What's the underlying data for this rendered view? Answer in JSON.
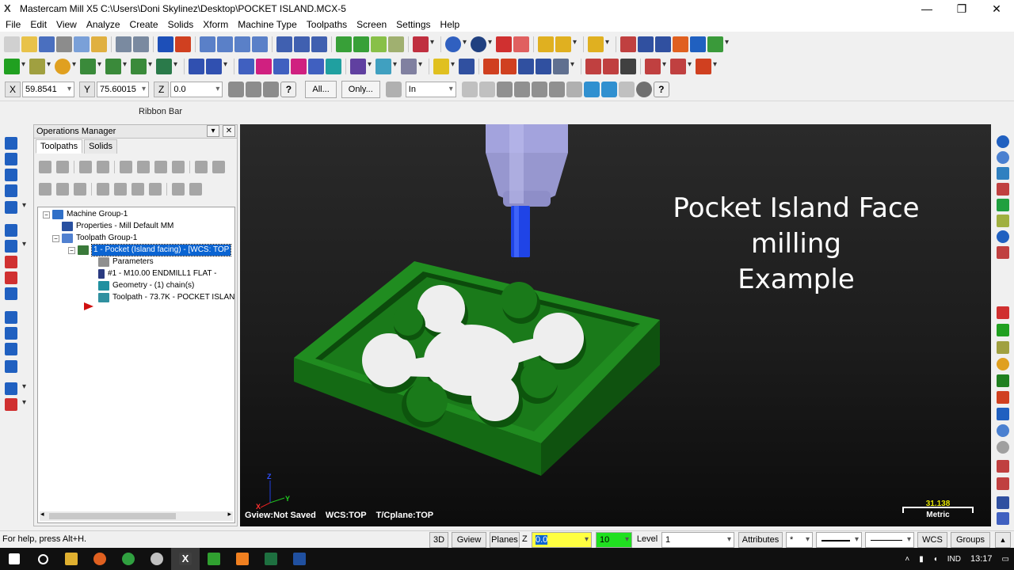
{
  "titlebar": {
    "title": "Mastercam Mill X5  C:\\Users\\Doni Skylinez\\Desktop\\POCKET ISLAND.MCX-5",
    "minimize": "—",
    "maximize": "❐",
    "close": "✕"
  },
  "menu": [
    "File",
    "Edit",
    "View",
    "Analyze",
    "Create",
    "Solids",
    "Xform",
    "Machine Type",
    "Toolpaths",
    "Screen",
    "Settings",
    "Help"
  ],
  "ribbon": {
    "x_label": "X",
    "x_value": "59.8541",
    "y_label": "Y",
    "y_value": "75.60015",
    "z_label": "Z",
    "z_value": "0.0",
    "all_button": "All...",
    "only_button": "Only...",
    "units_select": "In",
    "ribbon_bar_label": "Ribbon Bar"
  },
  "ops_manager": {
    "title": "Operations Manager",
    "tabs": [
      "Toolpaths",
      "Solids"
    ],
    "tree": {
      "machine_group": "Machine Group-1",
      "properties": "Properties - Mill Default MM",
      "toolpath_group": "Toolpath Group-1",
      "operation": "1 - Pocket (Island facing) - [WCS: TOP",
      "parameters": "Parameters",
      "tool": "#1 - M10.00 ENDMILL1 FLAT -",
      "geometry": "Geometry - (1) chain(s)",
      "toolpath": "Toolpath - 73.7K - POCKET ISLANI"
    }
  },
  "viewport": {
    "title_line1": "Pocket Island Face milling",
    "title_line2": "Example",
    "status": {
      "gview": "Gview:Not Saved",
      "wcs": "WCS:TOP",
      "tplane": "T/Cplane:TOP"
    },
    "axis_z": "Z",
    "axis_x": "X",
    "axis_y": "Y",
    "scale_value": "31.138",
    "scale_unit": "Metric"
  },
  "statusbar": {
    "help": "For help, press Alt+H.",
    "btn_3d": "3D",
    "btn_gview": "Gview",
    "btn_planes": "Planes",
    "z_label": "Z",
    "z_value": "0.0",
    "color_value": "10",
    "level_label": "Level",
    "level_value": "1",
    "attributes": "Attributes",
    "point_style": "*",
    "wcs": "WCS",
    "groups": "Groups"
  },
  "taskbar": {
    "time": "13:17",
    "lang": "IND"
  },
  "colors": {
    "part_green": "#1f8a1f",
    "part_green_dark": "#136313",
    "island_white": "#eeeeee",
    "tool_holder": "#9a9ad6",
    "tool_cutter": "#1d3fe0",
    "selection_blue": "#0a64d2"
  }
}
